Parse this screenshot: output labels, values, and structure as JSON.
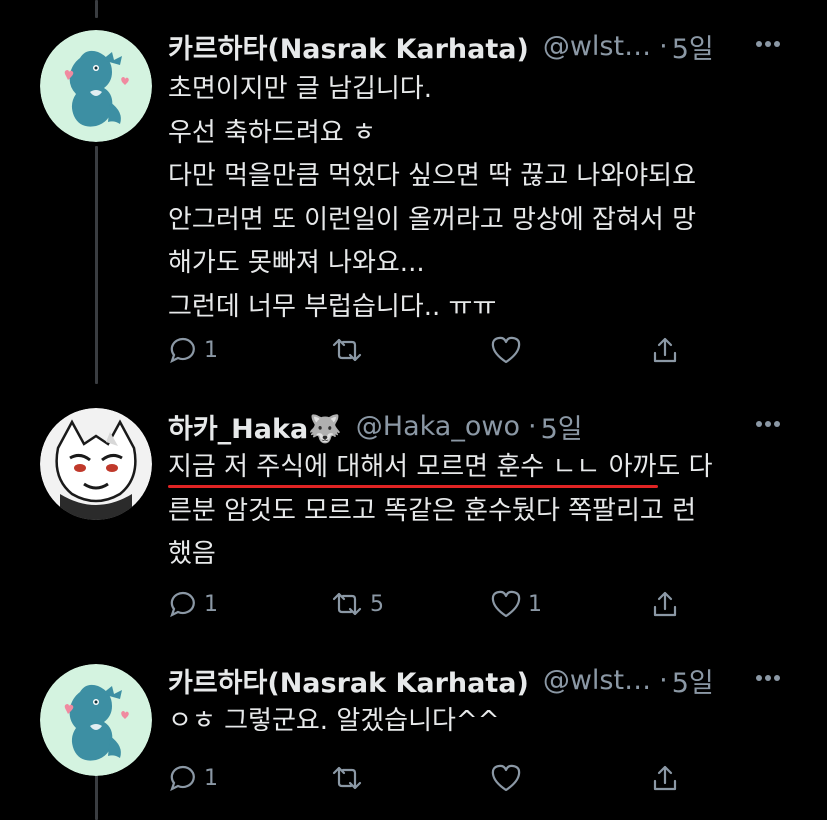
{
  "tweets": [
    {
      "name": "카르하타(Nasrak Karhata)",
      "handle": "@wlst…",
      "time": "5일",
      "lines": [
        "초면이지만 글 남깁니다.",
        "우선 축하드려요 ㅎ",
        "다만 먹을만큼 먹었다 싶으면 딱 끊고 나와야되요",
        "안그러면 또 이런일이 올꺼라고 망상에 잡혀서 망",
        "해가도 못빠져 나와요...",
        "그런데 너무 부럽습니다.. ㅠㅠ"
      ],
      "counts": {
        "reply": "1",
        "retweet": "",
        "like": ""
      },
      "avatar": "blue-dragon-mascot"
    },
    {
      "name": "하카_Haka🐺",
      "handle": "@Haka_owo",
      "time": "5일",
      "lines": [
        "지금 저 주식에 대해서 모르면 훈수 ㄴㄴ 아까도 다",
        "른분 암것도 모르고 똑같은 훈수뒀다 쪽팔리고 런",
        "했음"
      ],
      "counts": {
        "reply": "1",
        "retweet": "5",
        "like": "1"
      },
      "avatar": "white-wolf-character"
    },
    {
      "name": "카르하타(Nasrak Karhata)",
      "handle": "@wlst…",
      "time": "5일",
      "lines": [
        "ㅇㅎ 그렇군요. 알겠습니다^^"
      ],
      "counts": {
        "reply": "1",
        "retweet": "",
        "like": ""
      },
      "avatar": "blue-dragon-mascot"
    }
  ],
  "colors": {
    "background": "#000000",
    "text": "#e7e9ea",
    "muted": "#8b98a5",
    "thread_line": "#3a3d41",
    "highlight_underline": "#e02424",
    "avatar_bg": "#d4f3e0",
    "dragon": "#3d8fa3"
  }
}
